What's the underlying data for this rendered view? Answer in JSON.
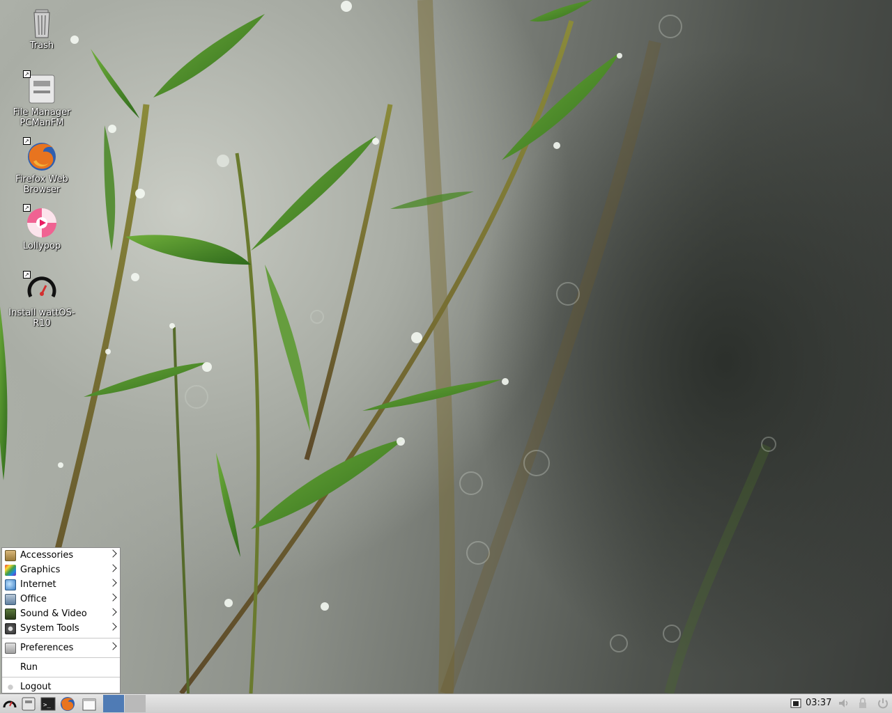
{
  "desktop_icons": [
    {
      "label": "Trash",
      "icon": "trash-icon"
    },
    {
      "label": "File Manager\nPCManFM",
      "icon": "file-manager-icon"
    },
    {
      "label": "Firefox Web\nBrowser",
      "icon": "firefox-icon"
    },
    {
      "label": "Lollypop",
      "icon": "lollypop-icon"
    },
    {
      "label": "Install wattOS-\nR10",
      "icon": "installer-gauge-icon"
    }
  ],
  "start_menu": {
    "items": [
      {
        "label": "Accessories",
        "icon": "accessories-icon",
        "submenu": true
      },
      {
        "label": "Graphics",
        "icon": "graphics-icon",
        "submenu": true
      },
      {
        "label": "Internet",
        "icon": "internet-icon",
        "submenu": true
      },
      {
        "label": "Office",
        "icon": "office-icon",
        "submenu": true
      },
      {
        "label": "Sound & Video",
        "icon": "sound-video-icon",
        "submenu": true
      },
      {
        "label": "System Tools",
        "icon": "system-tools-icon",
        "submenu": true
      }
    ],
    "preferences": {
      "label": "Preferences",
      "icon": "preferences-icon"
    },
    "run": {
      "label": "Run"
    },
    "logout": {
      "label": "Logout",
      "icon": "logout-icon"
    }
  },
  "taskbar": {
    "launchers": [
      "menu-gauge-icon",
      "file-manager-icon",
      "terminal-icon",
      "firefox-icon",
      "show-desktop-icon"
    ],
    "clock": "03:37",
    "tray": [
      "network-icon",
      "volume-icon",
      "lock-icon",
      "power-icon"
    ]
  },
  "colors": {
    "pager_active": "#4f7bb5",
    "pager_inactive": "#b9b9b9",
    "taskbar": "#d8d8d8"
  }
}
